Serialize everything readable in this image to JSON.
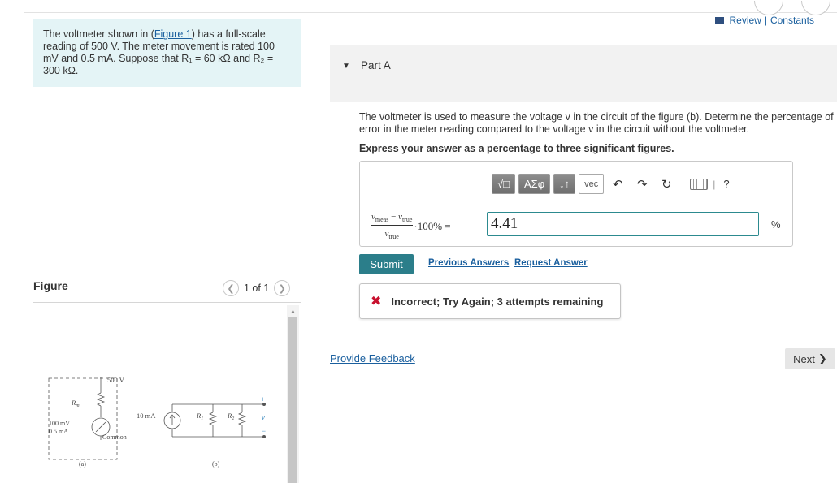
{
  "problem": {
    "text_before_link": "The voltmeter shown in (",
    "figure_link": "Figure 1",
    "text_after_link": ") has a full-scale reading of 500 V. The meter movement is rated 100 mV and 0.5 mA. Suppose that R₁ = 60 kΩ and R₂ = 300 kΩ."
  },
  "figure_panel": {
    "label": "Figure",
    "pager": "1 of 1",
    "circuit": {
      "full_scale": "500 V",
      "rm": "R",
      "rm_sub": "m",
      "movement_v": "100 mV",
      "movement_i": "0.5 mA",
      "common": "Common",
      "label_a": "(a)",
      "source": "10 mA",
      "r1": "R",
      "r1_sub": "1",
      "r2": "R",
      "r2_sub": "2",
      "plus": "+",
      "minus": "−",
      "v": "v",
      "label_b": "(b)"
    }
  },
  "header_links": {
    "review": "Review",
    "separator": "|",
    "constants": "Constants"
  },
  "part": {
    "title": "Part A",
    "question": "The voltmeter is used to measure the voltage v in the circuit of the figure (b). Determine the percentage of error in the meter reading compared to the voltage v in the circuit without the voltmeter.",
    "instructions": "Express your answer as a percentage to three significant figures."
  },
  "toolbar": {
    "template": "√□",
    "greek": "ΑΣφ",
    "arrows": "↓↑",
    "vec": "vec",
    "help": "?"
  },
  "formula": {
    "v_meas": "v",
    "meas_sub": "meas",
    "minus": "−",
    "v_true": "v",
    "true_sub": "true",
    "times": "·100% ="
  },
  "answer": {
    "value": "4.41",
    "unit": "%"
  },
  "actions": {
    "submit": "Submit",
    "previous_answers": "Previous Answers",
    "request_answer": "Request Answer"
  },
  "feedback": {
    "message": "Incorrect; Try Again; 3 attempts remaining"
  },
  "footer": {
    "provide_feedback": "Provide Feedback",
    "next": "Next"
  },
  "colors": {
    "problem_bg": "#e4f4f6",
    "submit_bg": "#2b7e8a",
    "link": "#1a5f9e",
    "error": "#c8102e"
  }
}
